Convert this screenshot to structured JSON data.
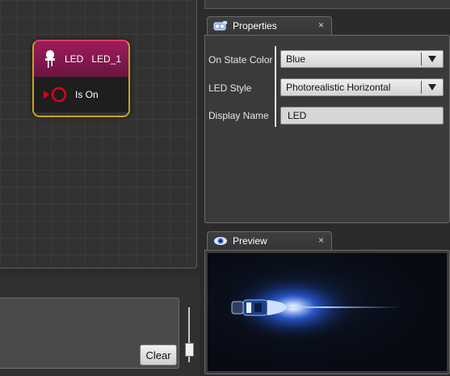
{
  "canvas": {
    "node": {
      "type_label": "LED",
      "name": "LED_1",
      "pin_label": "Is On"
    }
  },
  "log_panel": {
    "clear_label": "Clear"
  },
  "properties": {
    "tab_label": "Properties",
    "close_glyph": "×",
    "rows": [
      {
        "label": "On State Color",
        "value": "Blue"
      },
      {
        "label": "LED Style",
        "value": "Photorealistic Horizontal"
      },
      {
        "label": "Display Name",
        "value": "LED"
      }
    ]
  },
  "preview": {
    "tab_label": "Preview",
    "close_glyph": "×",
    "glow_color": "#2f6bff"
  },
  "colors": {
    "node_header": "#9e1c5b",
    "node_border": "#c9a51c",
    "pin_red": "#e0001a"
  },
  "icons": {
    "node_icon": "led-bulb-icon",
    "pin_icon": "output-pin-icon",
    "properties_icon": "properties-icon",
    "preview_icon": "eye-icon"
  }
}
